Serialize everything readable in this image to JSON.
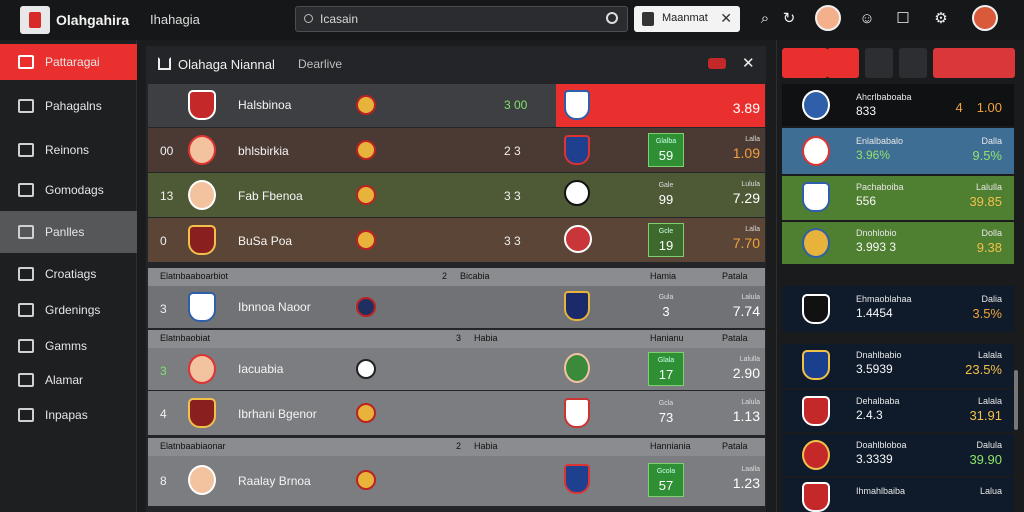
{
  "header": {
    "brand": "Olahgahira",
    "page_label": "Ihahagia",
    "search_placeholder": "Icasain",
    "user_chip": "Maanmat",
    "user_chip_close": "✕"
  },
  "sidebar": {
    "items": [
      {
        "label": "Pattaragai",
        "active": true
      },
      {
        "label": "Pahagalns"
      },
      {
        "label": "Reinons"
      },
      {
        "label": "Gomodags"
      },
      {
        "label": "Panlles",
        "selected": true
      },
      {
        "label": "Croatiags"
      },
      {
        "label": "Grdenings"
      },
      {
        "label": "Gamms"
      },
      {
        "label": "Alamar"
      },
      {
        "label": "Inpapas"
      }
    ]
  },
  "main": {
    "title": "Olahaga Niannal",
    "subtitle": "Dearlive",
    "close": "✕",
    "rows_top": [
      {
        "num": "",
        "name": "Halsbinoa",
        "score": "3  00",
        "odd": "3.89",
        "odd_label": "",
        "gval": "",
        "glabel": ""
      },
      {
        "num": "00",
        "name": "bhlsbirkia",
        "score": "2  3",
        "odd": "1.09",
        "odd_label": "Lalla",
        "gval": "59",
        "glabel": "Glalba"
      },
      {
        "num": "13",
        "name": "Fab Fbenoa",
        "score": "3  3",
        "odd": "7.29",
        "odd_label": "Lulula",
        "gval": "99",
        "glabel": "Gale"
      },
      {
        "num": "0",
        "name": "BuSa Poa",
        "score": "3  3",
        "odd": "7.70",
        "odd_label": "Lalla",
        "gval": "19",
        "glabel": "Gcle"
      }
    ],
    "section1": {
      "a": "Elatnbaaboarbiot",
      "b": "Bicabia",
      "b_num": "2",
      "c": "Hamia",
      "d": "Patala"
    },
    "row_s1": {
      "num": "3",
      "name": "Ibnnoa Naoor",
      "odd": "7.74",
      "odd_label": "Lalula",
      "gval": "3",
      "glabel": "Gula"
    },
    "section2": {
      "a": "Elatnbaobiat",
      "b": "Habia",
      "b_num": "3",
      "c": "Hanianu",
      "d": "Patala"
    },
    "rows_s2": [
      {
        "num": "3",
        "name": "Iacuabia",
        "odd": "2.90",
        "odd_label": "Lalulla",
        "gval": "17",
        "glabel": "Glala"
      },
      {
        "num": "4",
        "name": "Ibrhani Bgenor",
        "odd": "1.13",
        "odd_label": "Lalula",
        "gval": "73",
        "glabel": "Gcla"
      }
    ],
    "section3": {
      "a": "Elatnbaabiaonar",
      "b": "Habia",
      "b_num": "2",
      "c": "Hanniania",
      "d": "Patala"
    },
    "row_s3": {
      "num": "8",
      "name": "Raalay Brnoa",
      "odd": "1.23",
      "odd_label": "Laalla",
      "gval": "57",
      "glabel": "Gcola"
    }
  },
  "right": {
    "cards": [
      {
        "l1": "Ahcrlbaboaba",
        "l2": "833",
        "r1": "4",
        "r2": "1.00",
        "bg": "#101113"
      },
      {
        "l1": "Enlalbabalo",
        "l2": "3.96%",
        "r1": "Dalla",
        "r2": "9.5%",
        "bg": "#3f6e95"
      },
      {
        "l1": "Pachaboiba",
        "l2": "556",
        "r1": "Lalulla",
        "r2": "39.85",
        "bg": "#4f7f30"
      },
      {
        "l1": "Dnohlobio",
        "l2": "3.993 3",
        "r1": "Dolla",
        "r2": "9.38",
        "bg": "#4f7f30"
      },
      {
        "l1": "Ehmaoblahaa",
        "l2": "1.4454",
        "r1": "Dalia",
        "r2": "3.5%",
        "bg": "#0f1b2b"
      },
      {
        "l1": "Dnahlbabio",
        "l2": "3.5939",
        "r1": "Lalala",
        "r2": "23.5%",
        "bg": "#0f1b2b"
      },
      {
        "l1": "Dehalbaba",
        "l2": "2.4.3",
        "r1": "Lalala",
        "r2": "31.91",
        "bg": "#0f1b2b"
      },
      {
        "l1": "Doahlbloboa",
        "l2": "3.3339",
        "r1": "Dalula",
        "r2": "39.90",
        "bg": "#0f1b2b"
      },
      {
        "l1": "Ihmahlbaiba",
        "l2": "",
        "r1": "Lalua",
        "r2": "",
        "bg": "#0f1b2b"
      }
    ]
  },
  "colors": {
    "accent_red": "#e9302f",
    "green": "#2f8f34",
    "orange": "#f0a23a"
  }
}
